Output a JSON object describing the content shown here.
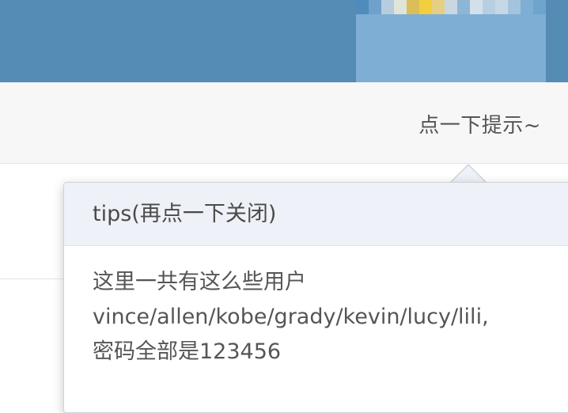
{
  "header": {
    "avatar_icon": "user-avatar-icon",
    "colors": {
      "top_bar": "#548cb5",
      "sub_bar": "#f7f7f7",
      "popover_header": "#eef1f7"
    }
  },
  "toolbar": {
    "hint_label": "点一下提示~"
  },
  "tips_popover": {
    "title": "tips(再点一下关闭)",
    "lines": [
      "这里一共有这么些用户",
      "vince/allen/kobe/grady/kevin/lucy/lili,",
      "密码全部是123456"
    ]
  }
}
